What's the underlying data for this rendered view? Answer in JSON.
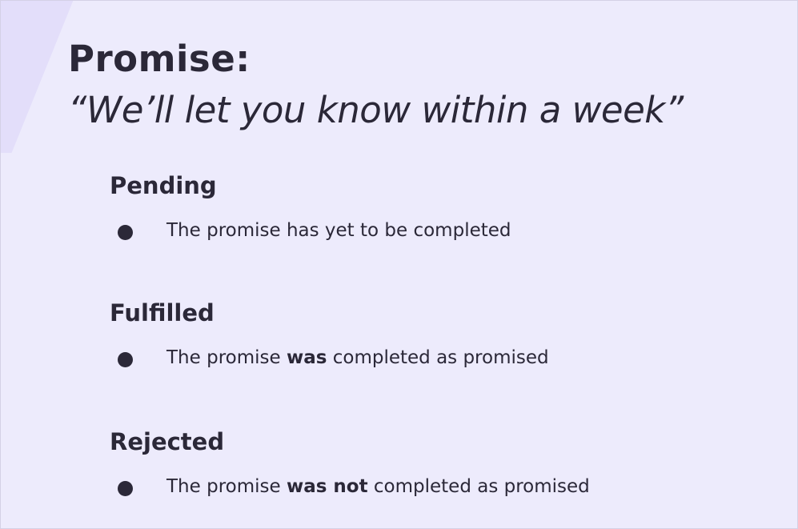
{
  "slide": {
    "title": "Promise:",
    "subtitle": "“We’ll let you know within a week”"
  },
  "states": {
    "pending": {
      "heading": "Pending",
      "text": "The promise has yet to be completed"
    },
    "fulfilled": {
      "heading": "Fulfilled",
      "text_before": "The promise ",
      "text_bold": "was",
      "text_after": " completed as promised"
    },
    "rejected": {
      "heading": "Rejected",
      "text_before": "The promise ",
      "text_bold": "was not",
      "text_after": " completed as promised"
    }
  },
  "colors": {
    "background": "#edebfc",
    "text": "#2b2838",
    "accent_shape": "#e3defa"
  }
}
